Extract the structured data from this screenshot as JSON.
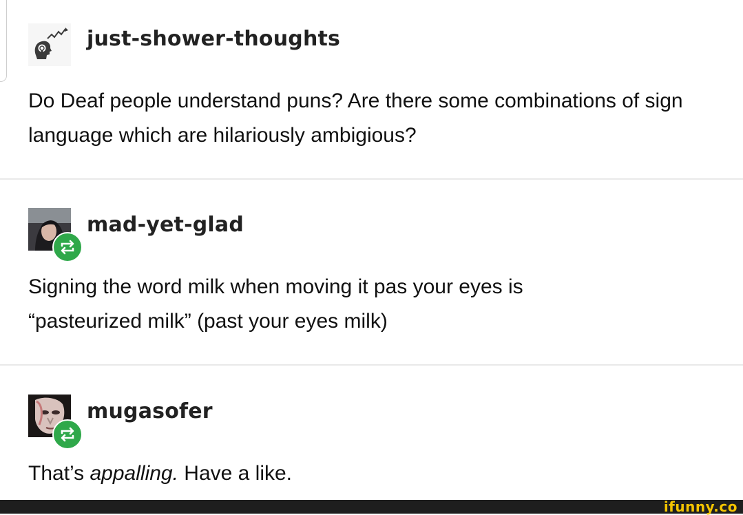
{
  "posts": [
    {
      "username": "just-shower-thoughts",
      "text": "Do Deaf people understand puns? Are there some combinations of sign language which are hilariously ambigious?"
    },
    {
      "username": "mad-yet-glad",
      "text": "Signing the word milk when moving it pas your eyes is “pasteurized milk” (past your eyes milk)"
    },
    {
      "username": "mugasofer",
      "text_before": "That’s ",
      "text_italic": "appalling.",
      "text_after": " Have a like."
    }
  ],
  "watermark": "ifunny.co",
  "colors": {
    "reblog_badge": "#2fa84a",
    "watermark": "#f4c400",
    "footer": "#1e1e1e",
    "divider": "#e9e9e9"
  },
  "icons": {
    "post1_avatar": "lightbulb-head-icon",
    "reblog": "reblog-icon"
  }
}
